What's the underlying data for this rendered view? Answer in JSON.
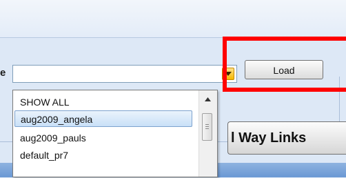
{
  "form": {
    "label_fragment": "e",
    "combo_value": "",
    "load_label": "Load"
  },
  "dropdown": {
    "items": [
      "SHOW ALL",
      "aug2009_angela",
      "aug2009_pauls",
      "default_pr7"
    ],
    "selected_index": 1
  },
  "toolbar": {
    "way_links_label": "l Way Links"
  },
  "colors": {
    "highlight": "#ff0000",
    "combo_arrow": "#f5b800",
    "selection": "#c9e0f7"
  }
}
